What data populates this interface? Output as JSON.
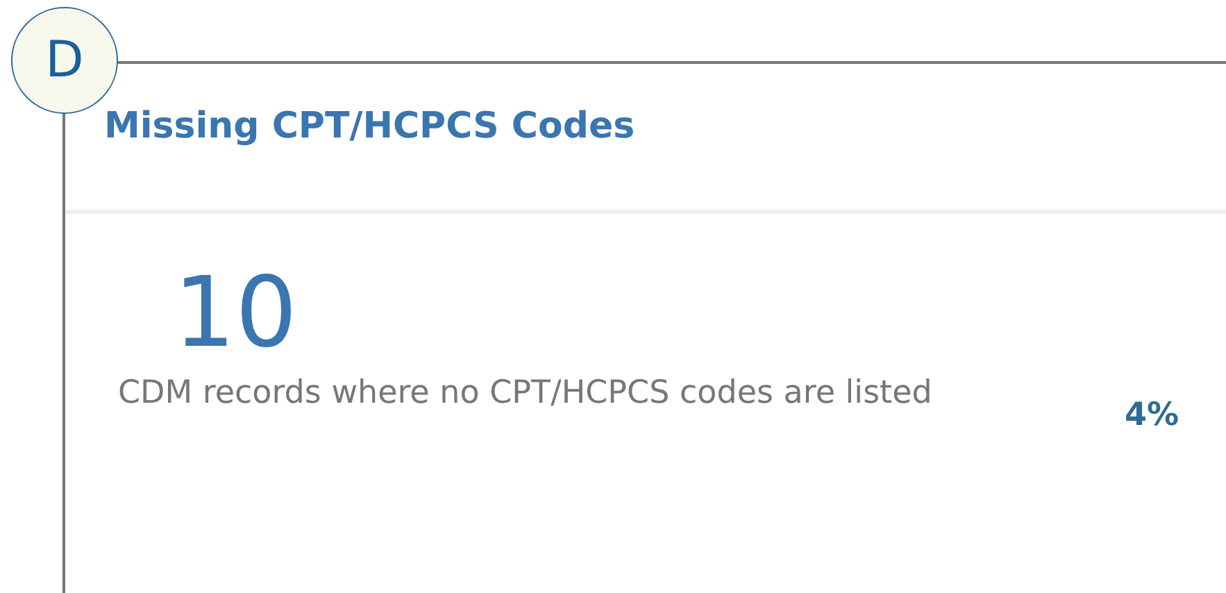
{
  "badge": {
    "letter": "D"
  },
  "card": {
    "title": "Missing CPT/HCPCS Codes",
    "metric": {
      "value": "10",
      "description": "CDM records where no CPT/HCPCS codes are listed",
      "percent": "4%"
    }
  }
}
